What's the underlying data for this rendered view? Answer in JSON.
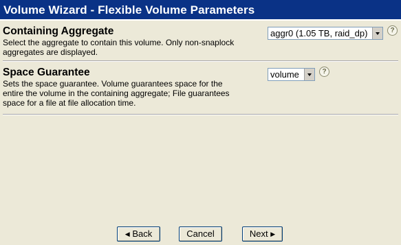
{
  "window": {
    "title": "Volume Wizard - Flexible Volume Parameters"
  },
  "sections": [
    {
      "heading": "Containing Aggregate",
      "description_lines": [
        "Select the aggregate to contain this volume. Only non-snaplock",
        "aggregates are displayed."
      ],
      "select_value": "aggr0 (1.05 TB, raid_dp)",
      "help_icon": "help-question-icon"
    },
    {
      "heading": "Space Guarantee",
      "description_lines": [
        "Sets the space guarantee. Volume guarantees space for the",
        "entire the volume in the containing aggregate; File guarantees",
        "space for a file at file allocation time."
      ],
      "select_value": "volume",
      "help_icon": "help-question-icon"
    }
  ],
  "buttons": {
    "back": {
      "label": "Back",
      "icon": "chevron-left-icon"
    },
    "cancel": {
      "label": "Cancel"
    },
    "next": {
      "label": "Next",
      "icon": "chevron-right-icon"
    }
  },
  "colors": {
    "title_bar": "#0a3286",
    "background": "#ece9d8"
  }
}
